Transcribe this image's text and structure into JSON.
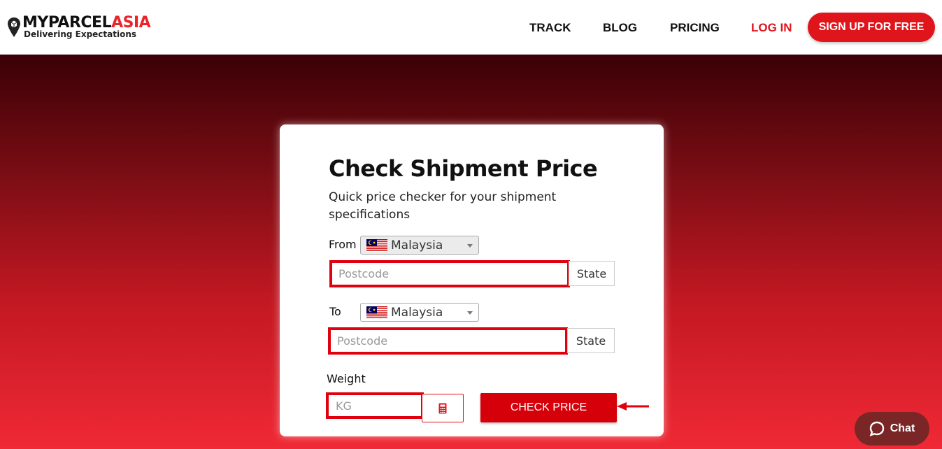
{
  "brand": {
    "name_main": "MYPARCEL",
    "name_accent": "ASIA",
    "tagline": "Delivering Expectations"
  },
  "nav": {
    "track": "TRACK",
    "blog": "BLOG",
    "pricing": "PRICING",
    "login": "LOG IN",
    "signup": "SIGN UP FOR FREE"
  },
  "form": {
    "title": "Check Shipment Price",
    "subtitle": "Quick price checker for your shipment specifications",
    "from_label": "From",
    "to_label": "To",
    "weight_label": "Weight",
    "from_country": "Malaysia",
    "to_country": "Malaysia",
    "postcode_placeholder": "Postcode",
    "state_label": "State",
    "weight_placeholder": "KG",
    "check_button": "CHECK PRICE"
  },
  "chat": {
    "label": "Chat"
  },
  "colors": {
    "accent": "#e0141b",
    "highlight": "#e0000e",
    "chat": "#7a2626"
  }
}
